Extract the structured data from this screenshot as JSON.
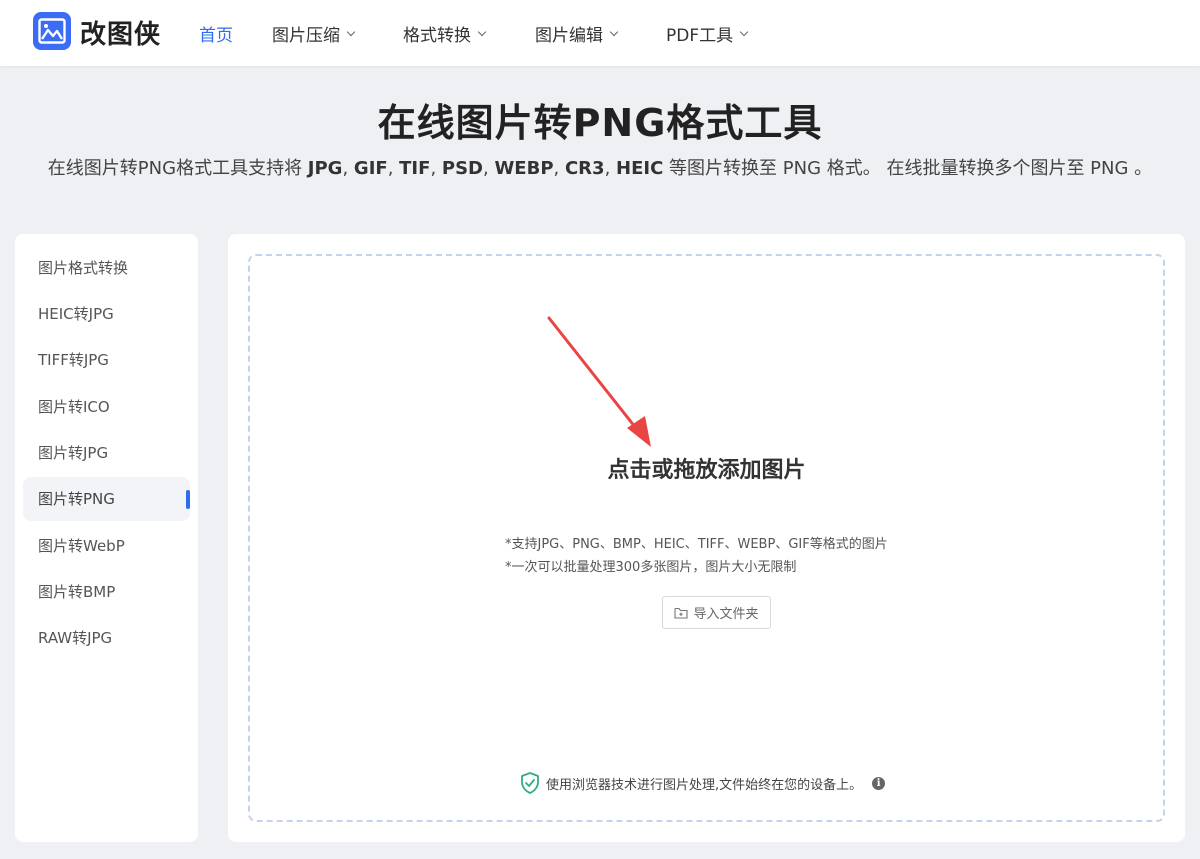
{
  "header": {
    "brand": "改图侠",
    "nav": [
      {
        "label": "首页",
        "active": true,
        "dropdown": false
      },
      {
        "label": "图片压缩",
        "active": false,
        "dropdown": true
      },
      {
        "label": "格式转换",
        "active": false,
        "dropdown": true
      },
      {
        "label": "图片编辑",
        "active": false,
        "dropdown": true
      },
      {
        "label": "PDF工具",
        "active": false,
        "dropdown": true
      }
    ]
  },
  "hero": {
    "title": "在线图片转PNG格式工具",
    "subtitle_prefix": "在线图片转PNG格式工具支持将 ",
    "formats": [
      "JPG",
      "GIF",
      "TIF",
      "PSD",
      "WEBP",
      "CR3",
      "HEIC"
    ],
    "subtitle_suffix": " 等图片转换至 PNG 格式。 在线批量转换多个图片至 PNG 。"
  },
  "sidebar": {
    "items": [
      {
        "label": "图片格式转换",
        "active": false
      },
      {
        "label": "HEIC转JPG",
        "active": false
      },
      {
        "label": "TIFF转JPG",
        "active": false
      },
      {
        "label": "图片转ICO",
        "active": false
      },
      {
        "label": "图片转JPG",
        "active": false
      },
      {
        "label": "图片转PNG",
        "active": true
      },
      {
        "label": "图片转WebP",
        "active": false
      },
      {
        "label": "图片转BMP",
        "active": false
      },
      {
        "label": "RAW转JPG",
        "active": false
      }
    ]
  },
  "upload": {
    "title": "点击或拖放添加图片",
    "hint1": "*支持JPG、PNG、BMP、HEIC、TIFF、WEBP、GIF等格式的图片",
    "hint2": "*一次可以批量处理300多张图片，图片大小无限制",
    "folder_button": "导入文件夹",
    "privacy": "使用浏览器技术进行图片处理,文件始终在您的设备上。",
    "info_glyph": "i"
  },
  "colors": {
    "accent": "#2d6cf0",
    "logo_bg": "#3b6cf5",
    "arrow": "#e94545",
    "shield": "#2fae7f",
    "dropzone_border": "#c3d3ee"
  }
}
